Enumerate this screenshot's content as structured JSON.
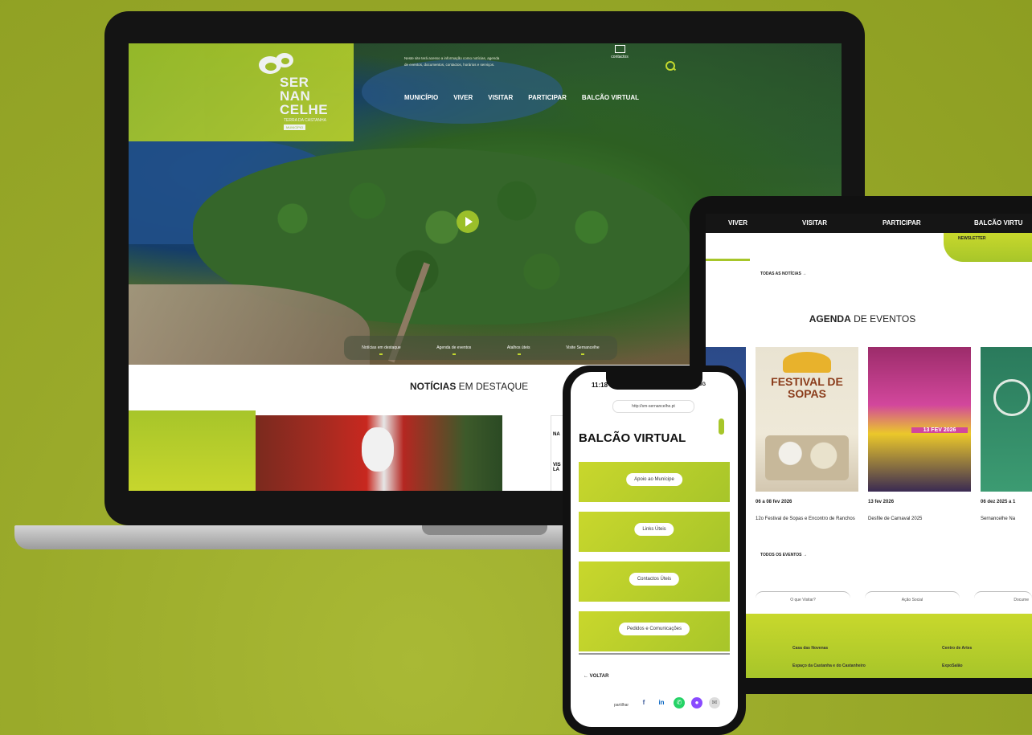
{
  "laptop": {
    "logo": {
      "line1": "SER",
      "line2": "NAN",
      "line3": "CELHE",
      "subtitle": "TERRA DA CASTANHA",
      "badge": "MUNICÍPIO"
    },
    "blurb": "Neste site terá acesso a informação como notícias, agenda de eventos, documentos, contactos, horários e serviços.",
    "contactos": "contactos",
    "nav": [
      "MUNICÍPIO",
      "VIVER",
      "VISITAR",
      "PARTICIPAR",
      "BALCÃO VIRTUAL"
    ],
    "quick_tabs": [
      "Notícias em destaque",
      "Agenda de eventos",
      "Atalhos úteis",
      "Visite Sernancelhe"
    ],
    "section_title_bold": "NOTÍCIAS",
    "section_title_rest": " EM DESTAQUE",
    "side_card_top": "NA",
    "side_card_bottom": "VIS LA"
  },
  "tablet": {
    "nav": [
      "VIVER",
      "VISITAR",
      "PARTICIPAR",
      "BALCÃO VIRTU"
    ],
    "newsletter": "NEWSLETTER",
    "todas_noticias": "TODAS AS NOTÍCIAS →",
    "agenda_bold": "AGENDA",
    "agenda_rest": " DE EVENTOS",
    "events": [
      {
        "date": "06 a 08 fev 2026",
        "name": "12o Festival de Sopas e Encontro de Ranchos",
        "poster_text": "FESTIVAL DE SOPAS"
      },
      {
        "date": "13 fev 2026",
        "name": "Desfile de Carnaval 2025",
        "poster_text": "13 FEV 2026"
      },
      {
        "date": "06 dez 2025 a 1",
        "name": "Sernancelhe Na",
        "poster_text": ""
      }
    ],
    "todos_eventos": "TODOS OS EVENTOS →",
    "pills": [
      "O que Visitar?",
      "Ação Social",
      "Docume"
    ],
    "footer_links": [
      "Casa das Novenas",
      "Centro de Artes",
      "Espaço da Castanha e do Castanheiro",
      "ExpoSalão"
    ]
  },
  "phone": {
    "time": "11:18",
    "status": "5G",
    "url": "http://sm-sernancelhe.pt",
    "title": "BALCÃO VIRTUAL",
    "cards": [
      "Apoio ao Munícipe",
      "Links Úteis",
      "Contactos Úteis",
      "Pedidos e Comunicações"
    ],
    "back": "← VOLTAR",
    "share_label": "partilhar",
    "share_icons": [
      "facebook-icon",
      "linkedin-icon",
      "whatsapp-icon",
      "messenger-icon",
      "email-icon"
    ]
  },
  "colors": {
    "background": "#9aaa2a",
    "accent": "#a7c62a"
  }
}
